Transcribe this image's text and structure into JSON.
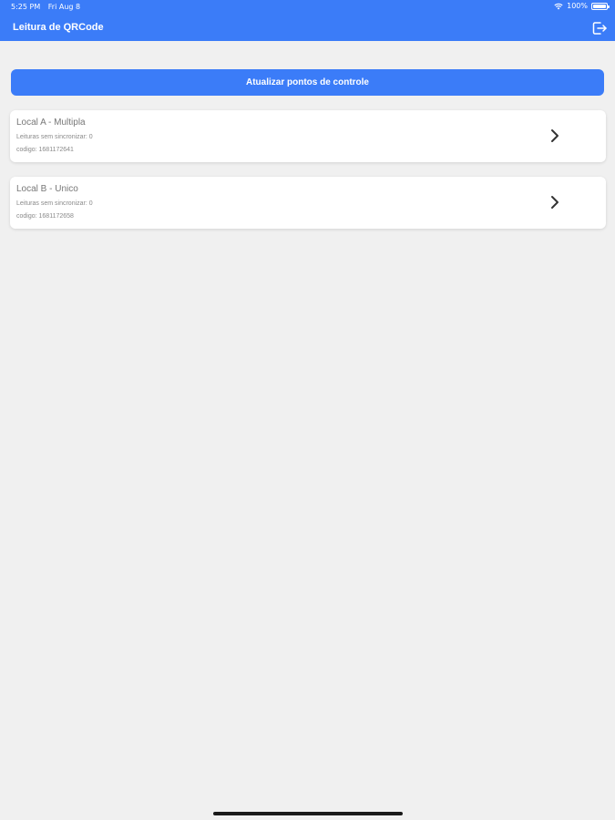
{
  "status_bar": {
    "time": "5:25 PM",
    "date": "Fri Aug 8",
    "battery_text": "100%",
    "battery_level": 1.0,
    "wifi_icon": "wifi-icon"
  },
  "header": {
    "title": "Leitura de QRCode",
    "logout_icon": "logout-icon"
  },
  "main": {
    "refresh_button": "Atualizar pontos de controle",
    "locations": [
      {
        "title": "Local A - Multipla",
        "sync_text": "Leituras sem sincronizar: 0",
        "code_text": "codigo: 1681172641"
      },
      {
        "title": "Local B - Unico",
        "sync_text": "Leituras sem sincronizar: 0",
        "code_text": "codigo: 1681172658"
      }
    ]
  },
  "colors": {
    "accent": "#3b7cf8",
    "background": "#f0f0f0",
    "card": "#ffffff"
  }
}
